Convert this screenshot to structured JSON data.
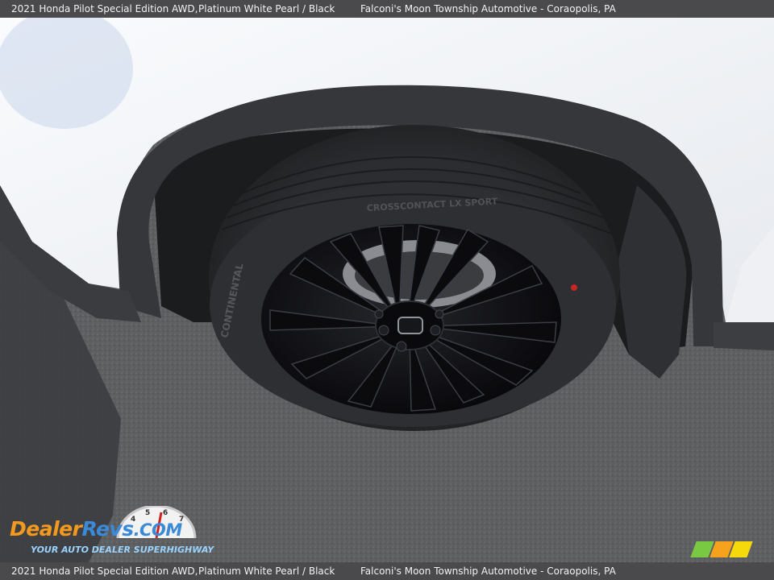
{
  "caption": {
    "vehicle": "2021 Honda Pilot Special Edition AWD,",
    "color": "Platinum White Pearl / Black",
    "dealer": "Falconi's Moon Township Automotive - Coraopolis, PA"
  },
  "tire": {
    "brand_text": "CONTINENTAL",
    "model_text": "CROSSCONTACT LX SPORT"
  },
  "watermark": {
    "brand_part_1": "Dealer",
    "brand_part_2": "Revs",
    "brand_part_3": ".COM",
    "tagline": "YOUR AUTO DEALER SUPERHIGHWAY",
    "dial_labels": [
      "4",
      "5",
      "6",
      "7"
    ]
  },
  "colors": {
    "caption_bar": "#4a4a4c",
    "body_paint": "#f4f6f9",
    "fender_trim": "#35373b",
    "asphalt": "#5f5f60",
    "tire": "#2a2b2d",
    "wheel": "#0d0d10",
    "watermark_orange": "#f39a1e",
    "watermark_blue": "#3a8ad8"
  }
}
